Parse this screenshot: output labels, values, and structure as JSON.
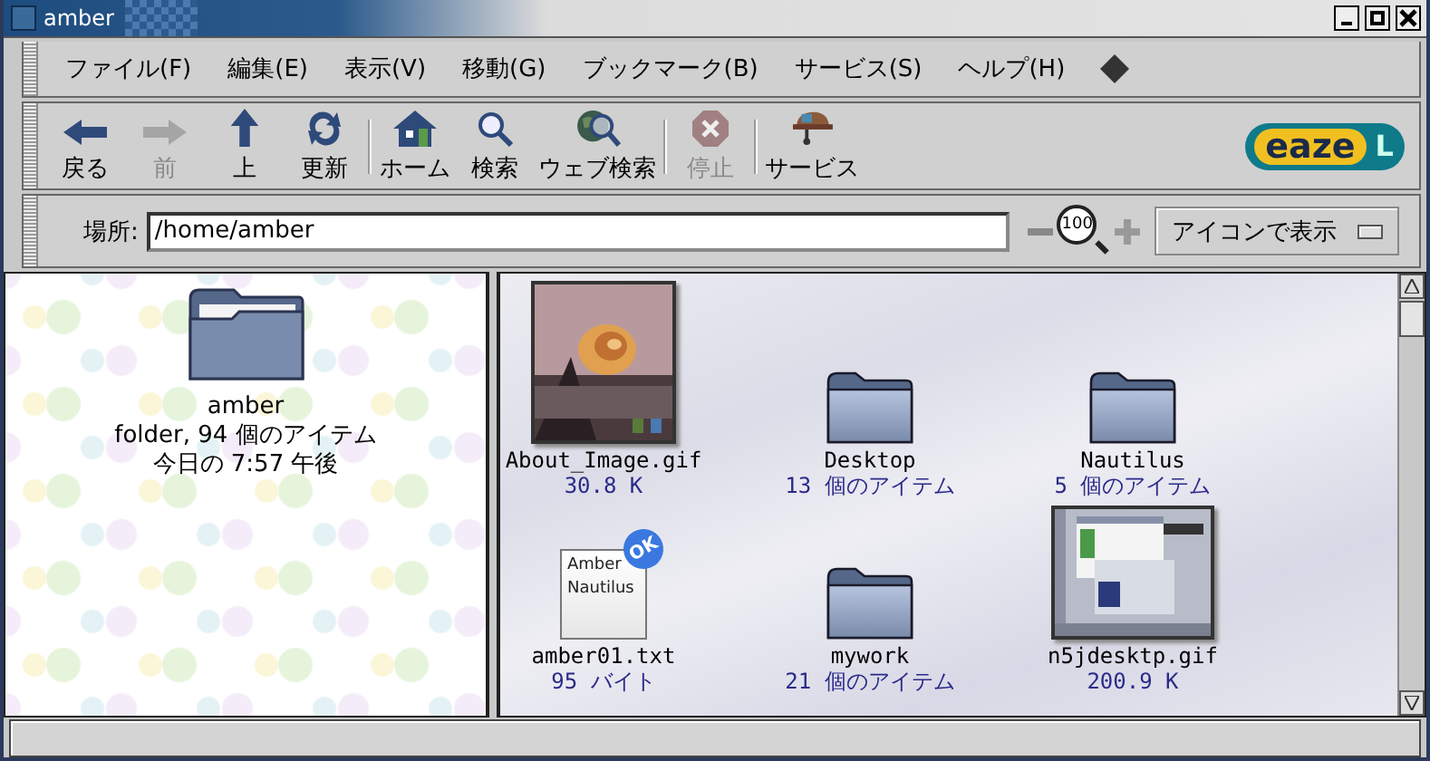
{
  "window": {
    "title": "amber"
  },
  "menu": [
    {
      "label": "ファイル(F)"
    },
    {
      "label": "編集(E)"
    },
    {
      "label": "表示(V)"
    },
    {
      "label": "移動(G)"
    },
    {
      "label": "ブックマーク(B)"
    },
    {
      "label": "サービス(S)"
    },
    {
      "label": "ヘルプ(H)"
    }
  ],
  "toolbar": {
    "groups": [
      [
        {
          "label": "戻る",
          "kind": "back",
          "disabled": false
        },
        {
          "label": "前",
          "kind": "forward",
          "disabled": true
        },
        {
          "label": "上",
          "kind": "up",
          "disabled": false
        },
        {
          "label": "更新",
          "kind": "reload",
          "disabled": false
        }
      ],
      [
        {
          "label": "ホーム",
          "kind": "home",
          "disabled": false
        },
        {
          "label": "検索",
          "kind": "search",
          "disabled": false
        },
        {
          "label": "ウェブ検索",
          "kind": "websearch",
          "disabled": false
        }
      ],
      [
        {
          "label": "停止",
          "kind": "stop",
          "disabled": true
        }
      ],
      [
        {
          "label": "サービス",
          "kind": "services",
          "disabled": false
        }
      ]
    ],
    "logo": {
      "word": "eaze",
      "mark": "L"
    }
  },
  "location": {
    "label": "場所:",
    "value": "/home/amber",
    "zoom": "100",
    "view": "アイコンで表示"
  },
  "sidebar": {
    "name": "amber",
    "info": "folder, 94 個のアイテム",
    "date": "今日の 7:57 午後"
  },
  "files": [
    {
      "name": "About_Image.gif",
      "info": "30.8 K"
    },
    {
      "name": "Desktop",
      "info": "13 個のアイテム",
      "kind": "folder"
    },
    {
      "name": "Nautilus",
      "info": "5 個のアイテム",
      "kind": "folder"
    },
    {
      "name": "amber01.txt",
      "info": "95 バイト",
      "kind": "text",
      "preview": [
        "Amber",
        "Nautilus"
      ],
      "emblem": "OK"
    },
    {
      "name": "mywork",
      "info": "21 個のアイテム",
      "kind": "folder"
    },
    {
      "name": "n5jdesktp.gif",
      "info": "200.9 K",
      "kind": "screenshot"
    }
  ]
}
